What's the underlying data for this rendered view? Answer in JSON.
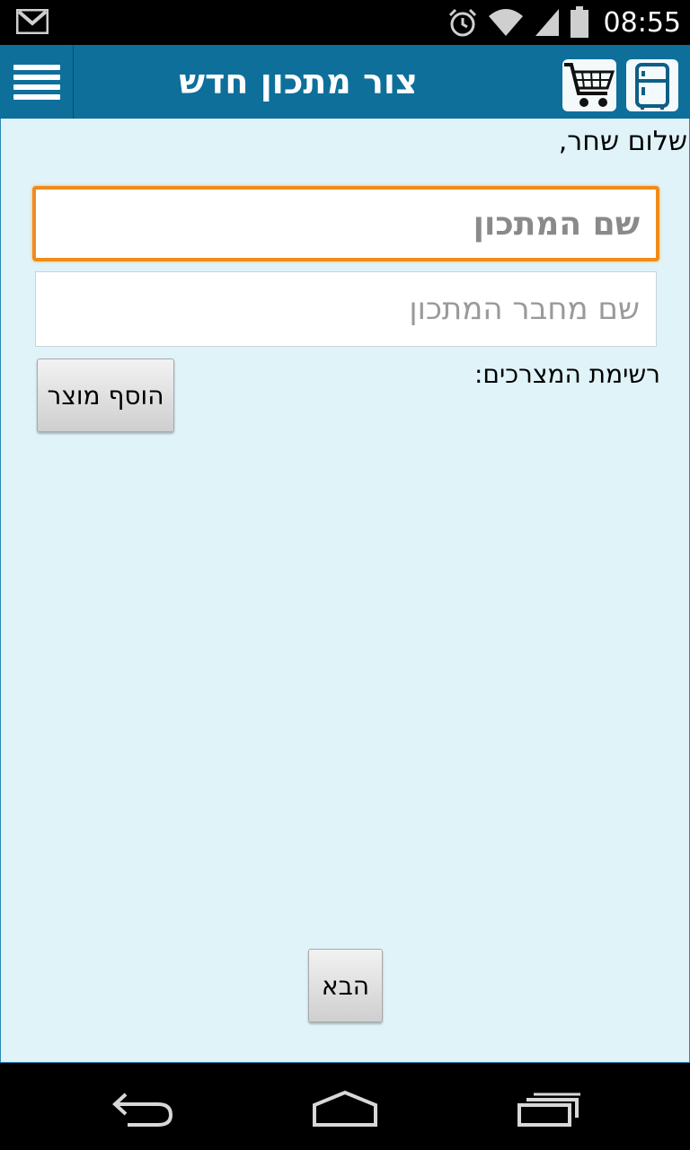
{
  "status_bar": {
    "time": "08:55",
    "icons": [
      "gmail-icon",
      "alarm-icon",
      "wifi-icon",
      "signal-icon",
      "battery-icon"
    ]
  },
  "action_bar": {
    "title": "צור מתכון חדש",
    "color": "#0e6f9b",
    "icons": [
      "menu-icon",
      "cart-icon",
      "fridge-icon"
    ]
  },
  "content": {
    "greeting": "שלום שחר,",
    "recipe_name_placeholder": "שם המתכון",
    "recipe_author_placeholder": "שם מחבר המתכון",
    "ingredients_label": "רשימת המצרכים:",
    "add_product_label": "הוסף מוצר",
    "next_label": "הבא",
    "background": "#dff3f9",
    "focus_color": "#f08c1a"
  },
  "nav_bar": {
    "icons": [
      "back-icon",
      "home-icon",
      "recents-icon"
    ]
  }
}
